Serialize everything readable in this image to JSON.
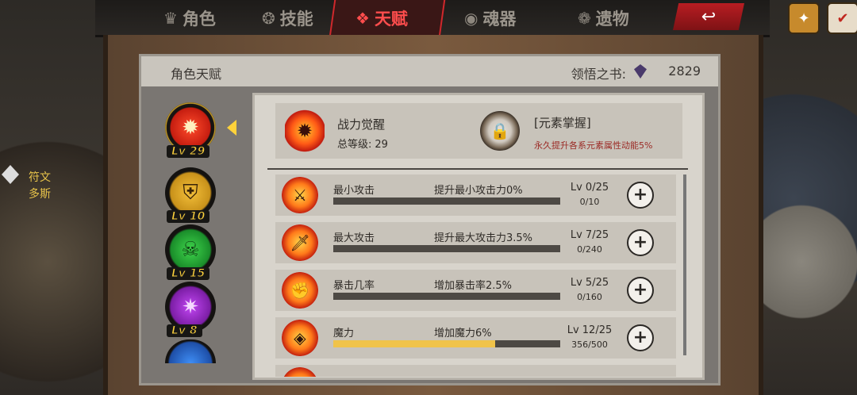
{
  "tabs": [
    {
      "label": "角色",
      "icon": "character-icon",
      "active": false
    },
    {
      "label": "技能",
      "icon": "skill-icon",
      "active": false
    },
    {
      "label": "天赋",
      "icon": "talent-icon",
      "active": true
    },
    {
      "label": "魂器",
      "icon": "soul-vessel-icon",
      "active": false
    },
    {
      "label": "遗物",
      "icon": "relic-icon",
      "active": false
    }
  ],
  "side": {
    "rune_label_1": "符文",
    "rune_label_2": "多斯"
  },
  "panel": {
    "title": "角色天赋",
    "crystal_label": "领悟之书:",
    "crystal_value": "2829"
  },
  "ranks": [
    {
      "level": "Lv 29",
      "color": "#e03a1e"
    },
    {
      "level": "Lv 10",
      "color": "#f0b52c"
    },
    {
      "level": "Lv 15",
      "color": "#3fc448"
    },
    {
      "level": "Lv 8",
      "color": "#b23fe0"
    },
    {
      "level": "",
      "color": "#3f8ef5"
    }
  ],
  "summary": {
    "title": "战力觉醒",
    "level_label": "总等级:",
    "level_value": "29",
    "element_title": "[元素掌握]",
    "element_desc": "永久提升各系元素属性动能5%"
  },
  "talents": [
    {
      "name": "最小攻击",
      "effect": "提升最小攻击力0%",
      "level": "Lv 0/25",
      "progress": "0/10",
      "fill": 0
    },
    {
      "name": "最大攻击",
      "effect": "提升最大攻击力3.5%",
      "level": "Lv 7/25",
      "progress": "0/240",
      "fill": 0
    },
    {
      "name": "暴击几率",
      "effect": "增加暴击率2.5%",
      "level": "Lv 5/25",
      "progress": "0/160",
      "fill": 0
    },
    {
      "name": "魔力",
      "effect": "增加魔力6%",
      "level": "Lv 12/25",
      "progress": "356/500",
      "fill": 0.712
    }
  ]
}
